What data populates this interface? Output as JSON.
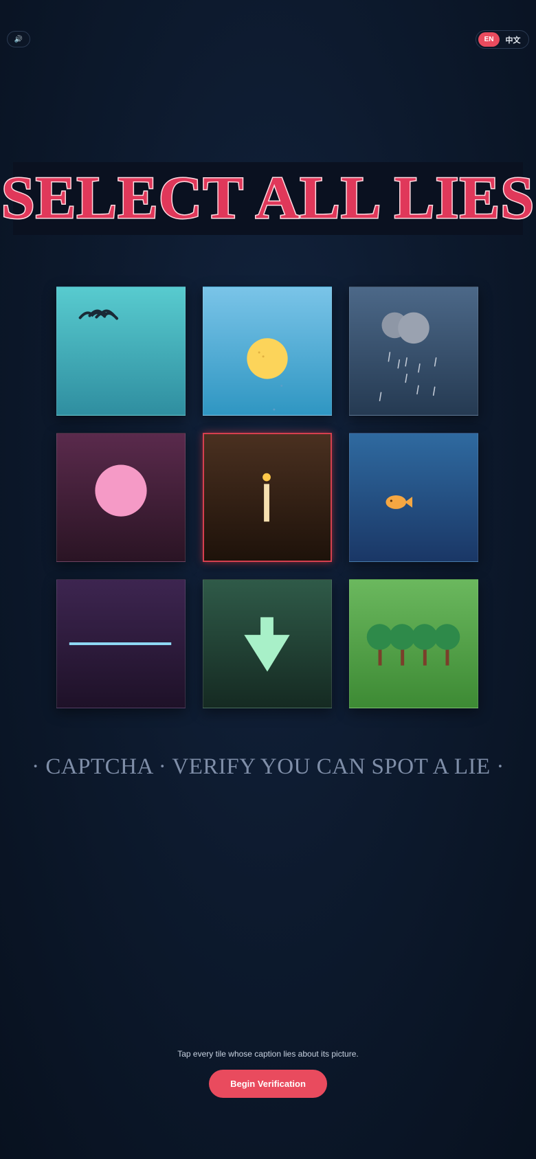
{
  "controls": {
    "sound_icon": "speaker-icon",
    "sound_glyph": "🔊",
    "lang_en": "EN",
    "lang_zh": "中文",
    "active_lang": "EN"
  },
  "title": "SELECT ALL LIES",
  "tiles": [
    {
      "name": "birds-tile",
      "icon": "birds-icon",
      "selected": false
    },
    {
      "name": "sun-tile",
      "icon": "sun-icon",
      "selected": false
    },
    {
      "name": "rain-cloud-tile",
      "icon": "rain-cloud-icon",
      "selected": false
    },
    {
      "name": "pink-circle-tile",
      "icon": "pink-circle-icon",
      "selected": false
    },
    {
      "name": "candle-tile",
      "icon": "candle-icon",
      "selected": true
    },
    {
      "name": "fish-tile",
      "icon": "fish-icon",
      "selected": false
    },
    {
      "name": "horizon-line-tile",
      "icon": "line-icon",
      "selected": false
    },
    {
      "name": "down-arrow-tile",
      "icon": "down-arrow-icon",
      "selected": false
    },
    {
      "name": "trees-tile",
      "icon": "trees-icon",
      "selected": false
    }
  ],
  "subtitle": "· CAPTCHA · VERIFY YOU CAN SPOT A LIE ·",
  "hint": "Tap every tile whose caption lies about its picture.",
  "begin_button": "Begin Verification",
  "colors": {
    "accent": "#e94b5e",
    "title_fill": "#e0385a",
    "selected_border": "#d6404f"
  }
}
